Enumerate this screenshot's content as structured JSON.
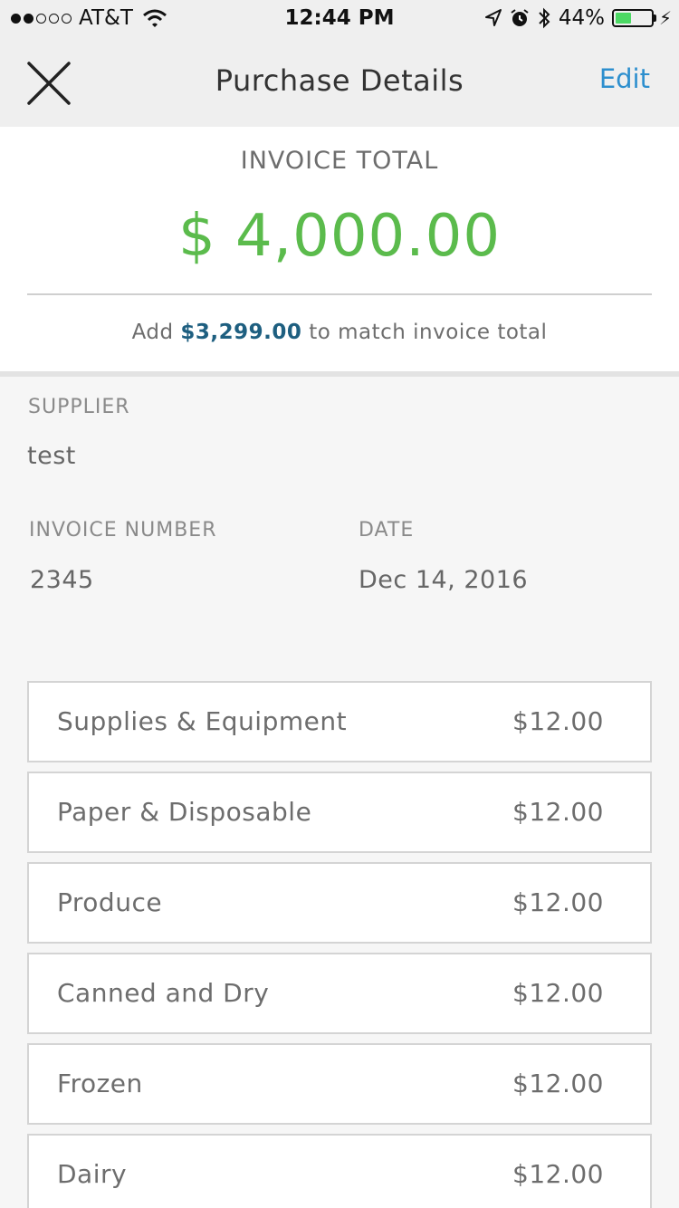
{
  "status_bar": {
    "carrier": "AT&T",
    "time": "12:44 PM",
    "battery_percent": "44%",
    "battery_level": 0.44,
    "battery_color": "#4cd964",
    "icons": [
      "signal-dots-icon",
      "wifi-icon",
      "location-arrow-icon",
      "alarm-icon",
      "bluetooth-icon",
      "battery-icon",
      "charging-bolt-icon"
    ]
  },
  "nav": {
    "title": "Purchase Details",
    "edit_label": "Edit",
    "close_icon": "close-icon",
    "accent_color": "#2d8fce"
  },
  "invoice_total": {
    "label": "INVOICE TOTAL",
    "amount": "$ 4,000.00",
    "amount_color": "#5bbb4c",
    "match_prefix": "Add",
    "match_amount": "$3,299.00",
    "match_suffix": "to match invoice total"
  },
  "details": {
    "supplier_label": "SUPPLIER",
    "supplier_value": "test",
    "invoice_number_label": "INVOICE NUMBER",
    "invoice_number_value": "2345",
    "date_label": "DATE",
    "date_value": "Dec 14, 2016"
  },
  "line_items": [
    {
      "name": "Supplies & Equipment",
      "price": "$12.00"
    },
    {
      "name": "Paper & Disposable",
      "price": "$12.00"
    },
    {
      "name": "Produce",
      "price": "$12.00"
    },
    {
      "name": "Canned and Dry",
      "price": "$12.00"
    },
    {
      "name": "Frozen",
      "price": "$12.00"
    },
    {
      "name": "Dairy",
      "price": "$12.00"
    }
  ]
}
